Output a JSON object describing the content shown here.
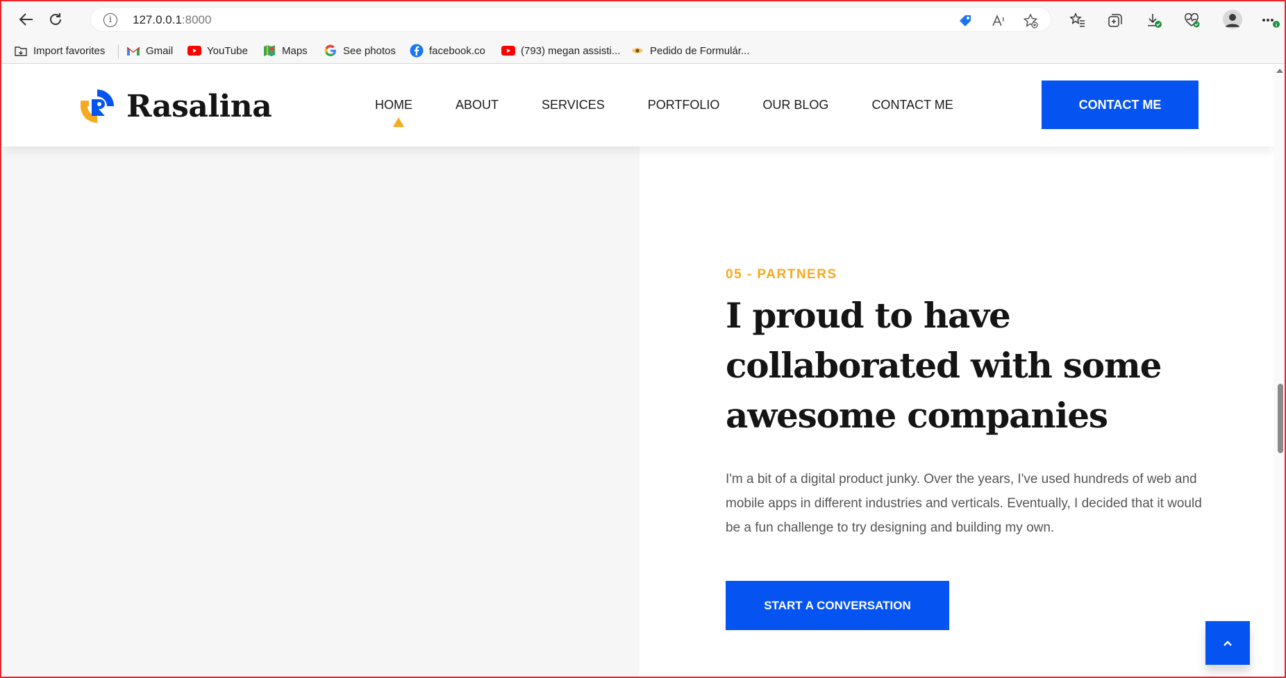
{
  "browser": {
    "url_host": "127.0.0.1",
    "url_port": ":8000"
  },
  "bookmarks": [
    {
      "label": "Import favorites",
      "icon": "import-favorites-icon"
    },
    {
      "label": "Gmail",
      "icon": "gmail-icon"
    },
    {
      "label": "YouTube",
      "icon": "youtube-icon"
    },
    {
      "label": "Maps",
      "icon": "maps-icon"
    },
    {
      "label": "See photos",
      "icon": "google-icon"
    },
    {
      "label": "facebook.co",
      "icon": "facebook-icon"
    },
    {
      "label": "(793) megan assisti...",
      "icon": "youtube-icon"
    },
    {
      "label": "Pedido de Formulár...",
      "icon": "eye-icon"
    }
  ],
  "site": {
    "logo_text": "Rasalina",
    "menu": [
      "HOME",
      "ABOUT",
      "SERVICES",
      "PORTFOLIO",
      "OUR BLOG",
      "CONTACT ME"
    ],
    "active_menu": "HOME",
    "cta_label": "CONTACT ME"
  },
  "section": {
    "eyebrow": "05 - PARTNERS",
    "headline": "I proud to have collaborated with some awesome companies",
    "description": "I'm a bit of a digital product junky. Over the years, I've used hundreds of web and mobile apps in different industries and verticals. Eventually, I decided that it would be a fun challenge to try designing and building my own.",
    "button_label": "START A CONVERSATION"
  },
  "colors": {
    "primary": "#0554f2",
    "accent": "#f7a920",
    "heading": "#141414",
    "body_text": "#555555",
    "left_panel": "#f6f6f6"
  }
}
